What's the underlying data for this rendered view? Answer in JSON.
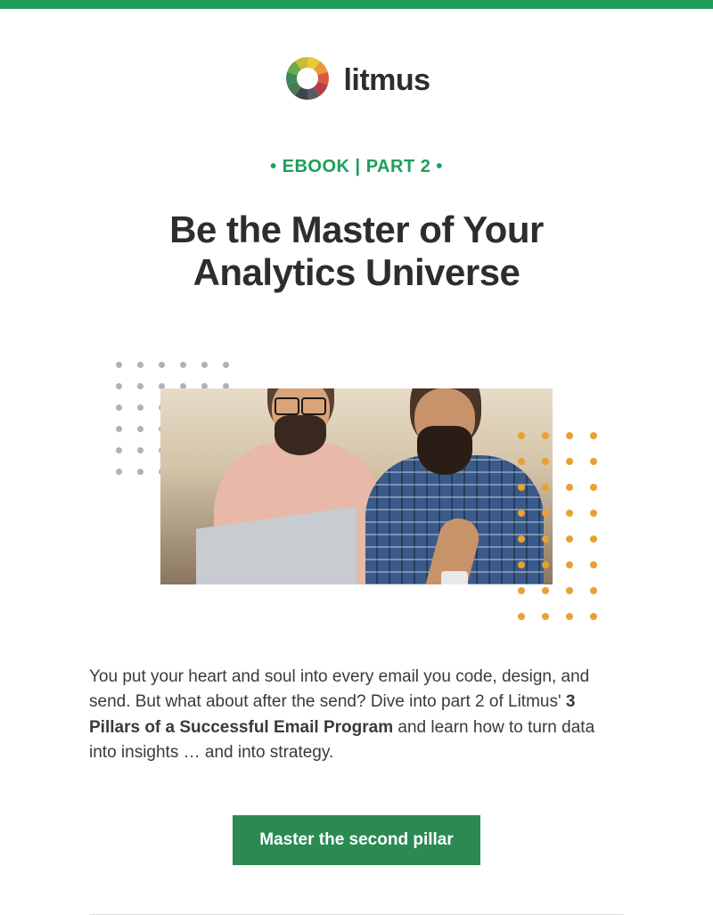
{
  "brand": {
    "name": "litmus"
  },
  "colors": {
    "accent": "#1e9e5a",
    "cta_bg": "#2a8a52",
    "text": "#2d2d2d"
  },
  "eyebrow": "• EBOOK | PART 2 •",
  "headline": "Be the Master of Your Analytics Universe",
  "body": {
    "pre": "You put your heart and soul into every email you code, design, and send. But what about after the send? Dive into part 2 of Litmus' ",
    "bold": "3 Pillars of a Successful Email Program",
    "post": " and learn how to turn data into insights … and into strategy."
  },
  "cta": {
    "label": "Master the second pillar"
  },
  "hero": {
    "alt": "Two people collaborating at a laptop",
    "decor_left": "grey-dot-grid",
    "decor_right": "orange-dot-grid"
  }
}
